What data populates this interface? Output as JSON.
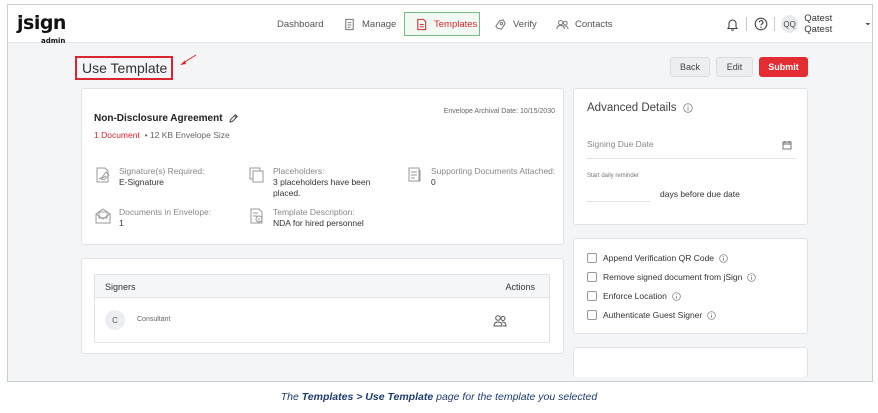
{
  "app": {
    "logo_main": "jsign",
    "logo_sub": "admin"
  },
  "nav": [
    {
      "label": "Dashboard"
    },
    {
      "label": "Manage"
    },
    {
      "label": "Templates",
      "active": true
    },
    {
      "label": "Verify"
    },
    {
      "label": "Contacts"
    }
  ],
  "user": {
    "initials": "QQ",
    "name": "Qatest Qatest"
  },
  "page": {
    "title": "Use Template"
  },
  "toolbar": {
    "back_label": "Back",
    "edit_label": "Edit",
    "submit_label": "Submit"
  },
  "envelope": {
    "name": "Non-Disclosure Agreement",
    "archival": "Envelope Archival Date: 10/15/2030",
    "doc_count": "1 Document",
    "size": "12 KB Envelope Size",
    "signature_label": "Signature(s) Required:",
    "signature_value": "E-Signature",
    "placeholders_label": "Placeholders:",
    "placeholders_value": "3 placeholders have been placed.",
    "supporting_label": "Supporting Documents Attached:",
    "supporting_value": "0",
    "docs_label": "Documents in Envelope:",
    "docs_value": "1",
    "desc_label": "Template Description:",
    "desc_value": "NDA for hired personnel"
  },
  "signers": {
    "header_signers": "Signers",
    "header_actions": "Actions",
    "rows": [
      {
        "initial": "C",
        "role": "Consultant"
      }
    ]
  },
  "advanced": {
    "title": "Advanced Details",
    "due_placeholder": "Signing Due Date",
    "reminder_label": "Start daily reminder",
    "reminder_suffix": "days before due date"
  },
  "options": [
    {
      "label": "Append Verification QR Code",
      "checked": false
    },
    {
      "label": "Remove signed document from jSign",
      "checked": false
    },
    {
      "label": "Enforce Location",
      "checked": false
    },
    {
      "label": "Authenticate Guest Signer",
      "checked": false
    }
  ],
  "caption": {
    "pre": "The ",
    "bold1": "Templates",
    "mid": " > ",
    "bold2": "Use Template",
    "post": " page for the template you selected"
  },
  "colors": {
    "accent": "#d9262f",
    "submit": "#e42d33",
    "caption": "#1f3b6e",
    "active_border": "#74b98a"
  }
}
